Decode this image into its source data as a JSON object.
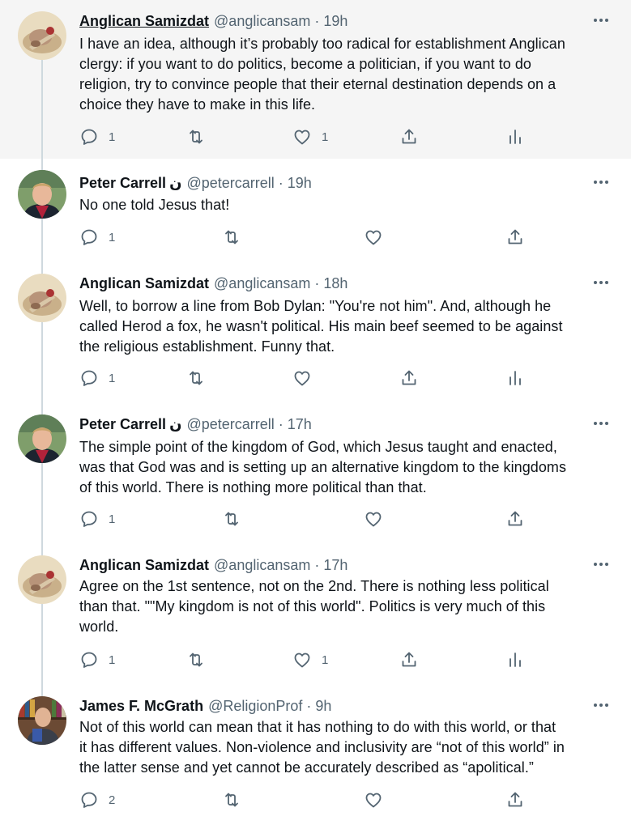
{
  "tweets": [
    {
      "name": "Anglican Samizdat",
      "name_suffix": "",
      "handle": "@anglicansam",
      "time": "19h",
      "lines": [
        "I have an idea, although it’s probably too radical for establishment Anglican",
        "clergy: if you want to do politics, become a politician, if you want to do",
        "religion, try to convince people that their eternal destination depends on a",
        "choice they have to make in this life."
      ],
      "reply_count": "1",
      "retweet_count": "",
      "like_count": "1",
      "avatar": "painting-avatar"
    },
    {
      "name": "Peter Carrell",
      "name_suffix": "ن",
      "handle": "@petercarrell",
      "time": "19h",
      "lines": [
        "No one told Jesus that!"
      ],
      "reply_count": "1",
      "retweet_count": "",
      "like_count": "",
      "avatar": "man-avatar"
    },
    {
      "name": "Anglican Samizdat",
      "name_suffix": "",
      "handle": "@anglicansam",
      "time": "18h",
      "lines": [
        "Well, to borrow a line from Bob Dylan: \"You're not him\". And, although he",
        "called Herod a fox, he wasn't political. His main beef seemed to be against",
        "the religious establishment. Funny that."
      ],
      "reply_count": "1",
      "retweet_count": "",
      "like_count": "",
      "avatar": "painting-avatar"
    },
    {
      "name": "Peter Carrell",
      "name_suffix": "ن",
      "handle": "@petercarrell",
      "time": "17h",
      "lines": [
        "The simple point of the kingdom of God, which Jesus taught and enacted,",
        "was that God was and is setting up an alternative kingdom to the kingdoms",
        "of this world. There is nothing more political than that."
      ],
      "reply_count": "1",
      "retweet_count": "",
      "like_count": "",
      "avatar": "man-avatar"
    },
    {
      "name": "Anglican Samizdat",
      "name_suffix": "",
      "handle": "@anglicansam",
      "time": "17h",
      "lines": [
        "Agree on the 1st sentence, not on the 2nd. There is nothing less political",
        "than that. \"\"My kingdom is not of this world\". Politics is very much of this",
        "world."
      ],
      "reply_count": "1",
      "retweet_count": "",
      "like_count": "1",
      "avatar": "painting-avatar"
    },
    {
      "name": "James F. McGrath",
      "name_suffix": "",
      "handle": "@ReligionProf",
      "time": "9h",
      "lines": [
        "Not of this world can mean that it has nothing to do with this world, or that",
        "it has different values. Non-violence and inclusivity are “not of this world” in",
        "the latter sense and yet cannot be accurately described as “apolitical.”"
      ],
      "reply_count": "2",
      "retweet_count": "",
      "like_count": "",
      "avatar": "bookshelf-avatar"
    }
  ],
  "separator": "·",
  "icons": {
    "reply": "reply-icon",
    "retweet": "retweet-icon",
    "like": "like-icon",
    "share": "share-icon",
    "analytics": "analytics-icon",
    "more": "more-icon"
  },
  "colors": {
    "text": "#0f1419",
    "muted": "#536471",
    "thread_line": "#cfd9de",
    "highlight_bg": "#f5f5f5"
  }
}
